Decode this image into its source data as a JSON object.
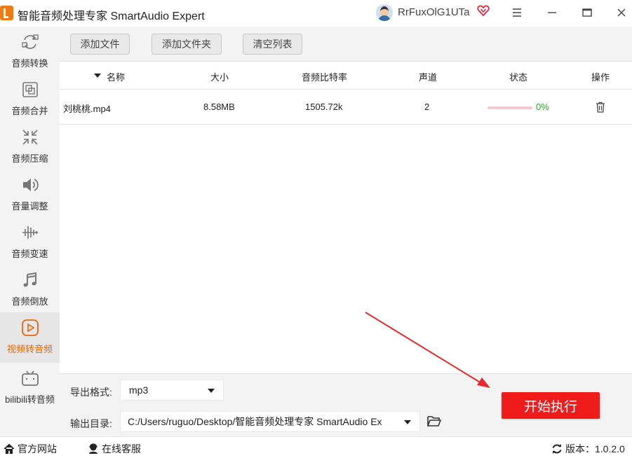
{
  "app": {
    "title": "智能音频处理专家 SmartAudio Expert"
  },
  "user": {
    "name": "RrFuxOlG1UTa"
  },
  "sidebar": {
    "items": [
      {
        "label": "音频转换",
        "icon": "audio-convert-icon"
      },
      {
        "label": "音频合并",
        "icon": "audio-merge-icon"
      },
      {
        "label": "音频压缩",
        "icon": "audio-compress-icon"
      },
      {
        "label": "音量调整",
        "icon": "volume-icon"
      },
      {
        "label": "音频变速",
        "icon": "speed-icon"
      },
      {
        "label": "音频倒放",
        "icon": "music-note-icon"
      },
      {
        "label": "视频转音频",
        "icon": "video-play-icon",
        "active": true
      },
      {
        "label": "bilibili转音频",
        "icon": "bilibili-icon"
      }
    ]
  },
  "toolbar": {
    "add_file": "添加文件",
    "add_folder": "添加文件夹",
    "clear_list": "清空列表"
  },
  "table": {
    "columns": [
      "名称",
      "大小",
      "音频比特率",
      "声道",
      "状态",
      "操作"
    ],
    "rows": [
      {
        "name": "刘桃桃.mp4",
        "size": "8.58MB",
        "bitrate": "1505.72k",
        "channels": "2",
        "progress": 0,
        "status": "0%"
      }
    ]
  },
  "bottom": {
    "format_label": "导出格式:",
    "format_value": "mp3",
    "dir_label": "输出目录:",
    "dir_value": "C:/Users/ruguo/Desktop/智能音频处理专家 SmartAudio Ex",
    "start_label": "开始执行"
  },
  "statusbar": {
    "website": "官方网站",
    "support": "在线客服",
    "version": "版本：1.0.2.0"
  },
  "colors": {
    "accent": "#e8660e",
    "start_button": "#f01c1c",
    "progress_text": "#22aa22"
  }
}
